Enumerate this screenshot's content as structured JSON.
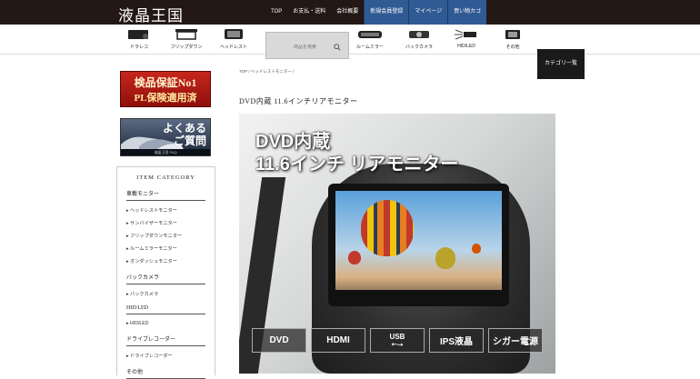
{
  "site": {
    "logo": "液晶王国"
  },
  "topnav": [
    {
      "label": "TOP",
      "highlight": false
    },
    {
      "label": "お支払・送料",
      "highlight": false
    },
    {
      "label": "会社概要",
      "highlight": false
    },
    {
      "label": "新規会員登録",
      "highlight": true
    },
    {
      "label": "マイページ",
      "highlight": true
    },
    {
      "label": "買い物カゴ",
      "highlight": true
    }
  ],
  "categories": [
    {
      "label": "ドラレコ",
      "icon": "dashcam-icon"
    },
    {
      "label": "フリップダウン",
      "icon": "flipdown-monitor-icon"
    },
    {
      "label": "ヘッドレスト",
      "icon": "headrest-monitor-icon"
    },
    {
      "label": "ルームミラー",
      "icon": "room-mirror-icon"
    },
    {
      "label": "バックカメラ",
      "icon": "back-camera-icon"
    },
    {
      "label": "HID/LED",
      "icon": "hid-led-icon"
    },
    {
      "label": "その他",
      "icon": "other-icon"
    }
  ],
  "search": {
    "placeholder": "商品を検索"
  },
  "all_categories_label": "カテゴリ一覧",
  "banners": {
    "warranty": {
      "line1": "検品保証No1",
      "line2": "PL保険適用済"
    },
    "faq": {
      "line1": "よくある",
      "line2": "ご質問",
      "caption": "液晶王国 FAQ"
    }
  },
  "sidebar": {
    "heading": "ITEM CATEGORY",
    "sections": [
      {
        "title": "車載モニター",
        "items": [
          "ヘッドレストモニター",
          "サンバイザーモニター",
          "フリップダウンモニター",
          "ルームミラーモニター",
          "オンダッシュモニター"
        ]
      },
      {
        "title": "バックカメラ",
        "items": [
          "バックカメラ"
        ]
      },
      {
        "title": "HID/LED",
        "items": [
          "HID/LED"
        ]
      },
      {
        "title": "ドライブレコーダー",
        "items": [
          "ドライブレコーダー"
        ]
      },
      {
        "title": "その他",
        "items": []
      }
    ]
  },
  "breadcrumb": "TOP / ヘッドレストモニター /",
  "page_title": "DVD内蔵 11.6インチリアモニター",
  "hero": {
    "line1": "DVD内蔵",
    "line2": "11.6インチ リアモニター",
    "badges": [
      "DVD",
      "HDMI",
      "USB",
      "IPS液晶",
      "シガー電源"
    ]
  }
}
